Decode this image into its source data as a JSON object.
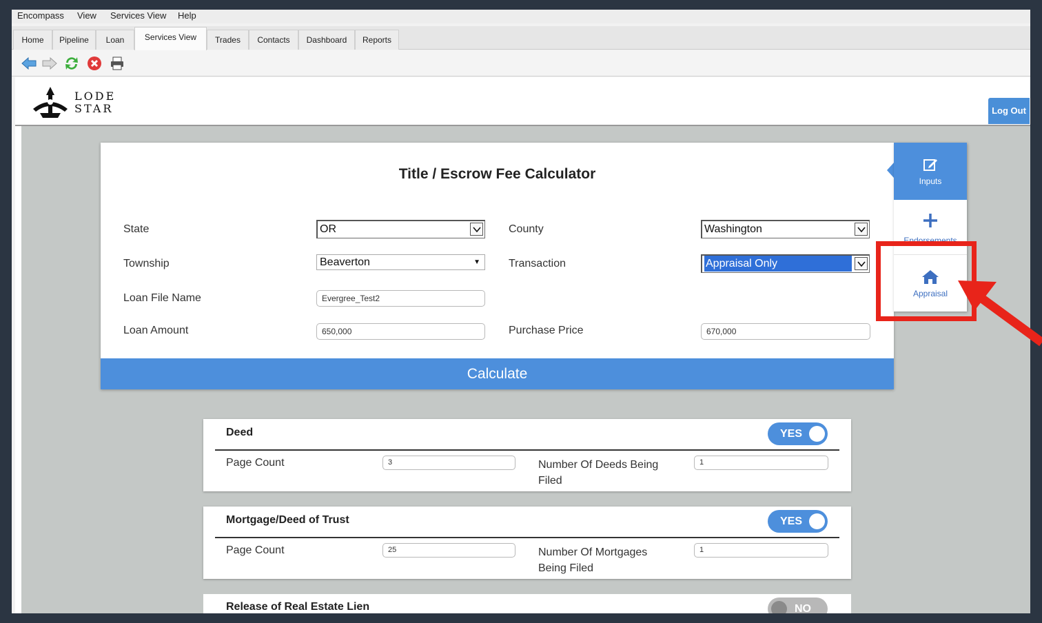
{
  "menu": [
    "Encompass",
    "View",
    "Services View",
    "Help"
  ],
  "tabs": [
    "Home",
    "Pipeline",
    "Loan",
    "Services View",
    "Trades",
    "Contacts",
    "Dashboard",
    "Reports"
  ],
  "active_tab": "Services View",
  "toolbar_icons": [
    "back-arrow-icon",
    "forward-arrow-icon",
    "refresh-icon",
    "stop-icon",
    "print-icon"
  ],
  "brand": {
    "line1": "LODE",
    "line2": "STAR"
  },
  "logout_label": "Log Out",
  "calculator": {
    "title": "Title / Escrow Fee Calculator",
    "state_label": "State",
    "state_value": "OR",
    "county_label": "County",
    "county_value": "Washington",
    "township_label": "Township",
    "township_value": "Beaverton",
    "transaction_label": "Transaction",
    "transaction_value": "Appraisal Only",
    "loan_file_label": "Loan File Name",
    "loan_file_value": "Evergree_Test2",
    "loan_amount_label": "Loan Amount",
    "loan_amount_value": "650,000",
    "purchase_price_label": "Purchase Price",
    "purchase_price_value": "670,000",
    "calculate_label": "Calculate"
  },
  "side_tabs": {
    "inputs": "Inputs",
    "endorsements": "Endorsements",
    "appraisal": "Appraisal"
  },
  "colors": {
    "accent": "#4d8fdc",
    "highlight": "#e8241a"
  },
  "deed": {
    "title": "Deed",
    "toggle": "YES",
    "page_count_label": "Page Count",
    "page_count_value": "3",
    "number_label": "Number Of Deeds Being Filed",
    "number_value": "1"
  },
  "mortgage": {
    "title": "Mortgage/Deed of Trust",
    "toggle": "YES",
    "page_count_label": "Page Count",
    "page_count_value": "25",
    "number_label": "Number Of Mortgages Being Filed",
    "number_value": "1"
  },
  "release": {
    "title": "Release of Real Estate Lien",
    "toggle": "NO"
  }
}
